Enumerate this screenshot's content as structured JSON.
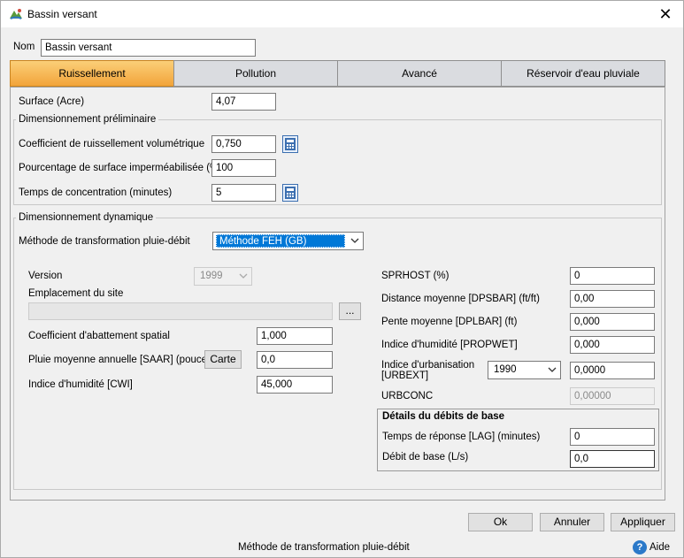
{
  "window": {
    "title": "Bassin versant"
  },
  "name_field": {
    "label": "Nom",
    "value": "Bassin versant"
  },
  "tabs": [
    {
      "label": "Ruissellement"
    },
    {
      "label": "Pollution"
    },
    {
      "label": "Avancé"
    },
    {
      "label": "Réservoir d'eau pluviale"
    }
  ],
  "surface": {
    "label": "Surface (Acre)",
    "value": "4,07"
  },
  "prelim": {
    "title": "Dimensionnement préliminaire",
    "coef_label": "Coefficient de ruissellement volumétrique",
    "coef_value": "0,750",
    "pct_label": "Pourcentage de surface imperméabilisée (%)",
    "pct_value": "100",
    "tc_label": "Temps de concentration (minutes)",
    "tc_value": "5"
  },
  "dynamic": {
    "title": "Dimensionnement dynamique",
    "method_label": "Méthode de transformation pluie-débit",
    "method_value": "Méthode FEH (GB)",
    "version_label": "Version",
    "version_value": "1999",
    "site_label": "Emplacement du site",
    "site_value": "",
    "browse_label": "...",
    "abat_label": "Coefficient d'abattement spatial",
    "abat_value": "1,000",
    "saar_label": "Pluie moyenne annuelle [SAAR] (pouce)",
    "carte_label": "Carte",
    "saar_value": "0,0",
    "cwi_label": "Indice d'humidité [CWI]",
    "cwi_value": "45,000",
    "sprhost_label": "SPRHOST (%)",
    "sprhost_value": "0",
    "dpsbar_label": "Distance moyenne [DPSBAR] (ft/ft)",
    "dpsbar_value": "0,00",
    "dplbar_label": "Pente moyenne [DPLBAR] (ft)",
    "dplbar_value": "0,000",
    "propwet_label": "Indice d'humidité [PROPWET]",
    "propwet_value": "0,000",
    "urbext_label_1": "Indice d'urbanisation",
    "urbext_label_2": "[URBEXT]",
    "urbext_year": "1990",
    "urbext_value": "0,0000",
    "urbconc_label": "URBCONC",
    "urbconc_value": "0,00000",
    "base": {
      "title": "Détails du débits de base",
      "lag_label": "Temps de réponse [LAG] (minutes)",
      "lag_value": "0",
      "flow_label": "Débit de base (L/s)",
      "flow_value": "0,0"
    }
  },
  "buttons": {
    "ok": "Ok",
    "cancel": "Annuler",
    "apply": "Appliquer"
  },
  "status": {
    "text": "Méthode de transformation pluie-débit",
    "help": "Aide"
  },
  "colors": {
    "active_tab": "#f2a43a",
    "selection": "#0078d7",
    "calc_icon": "#3c6fb0"
  }
}
